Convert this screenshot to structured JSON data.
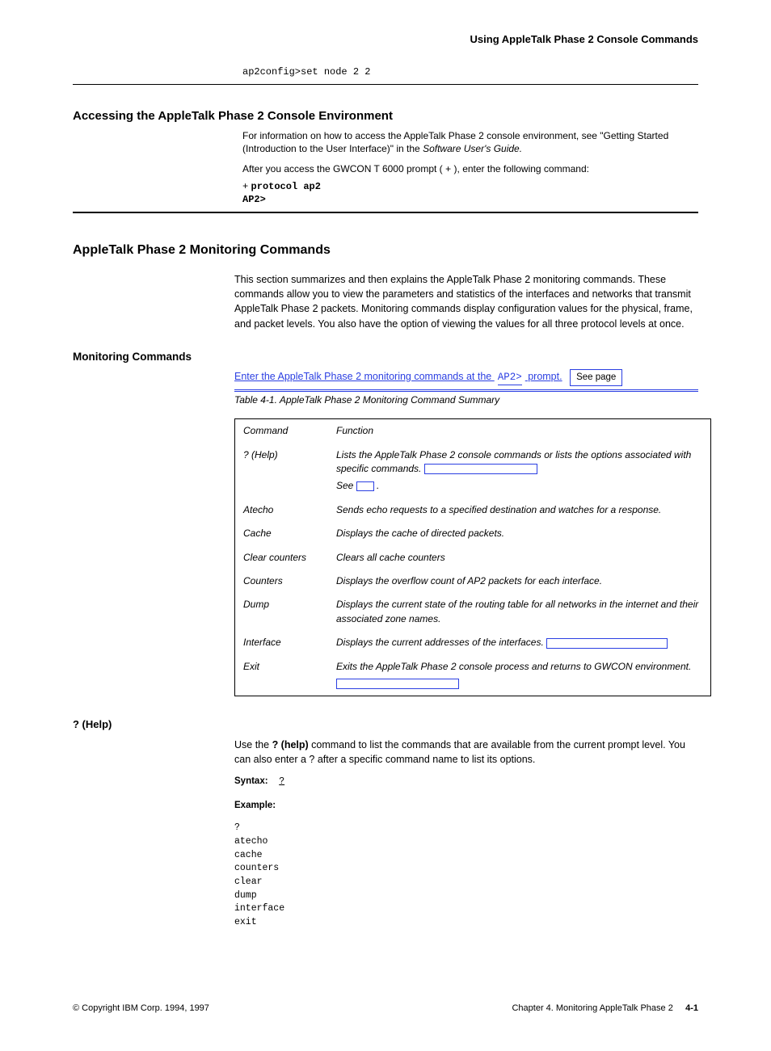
{
  "header": {
    "title": "Using AppleTalk Phase 2 Console Commands"
  },
  "top_example": "ap2config>set node 2 2",
  "section1": {
    "title": "Accessing the AppleTalk Phase 2 Console Environment",
    "line1_prefix": "For information on how to access the AppleTalk Phase 2 console environment, see",
    "line1_link": "\"Getting Started (Introduction to the User Interface)\"",
    "line1_suffix": " in the ",
    "line1_title": "Software User's Guide.",
    "plus": "+",
    "cmd": "protocol ap2",
    "promptline": "AP2>"
  },
  "section2": {
    "title": "AppleTalk Phase 2 Monitoring Commands",
    "para": "This section summarizes and then explains the AppleTalk Phase 2 monitoring commands. These commands allow you to view the parameters and statistics of the interfaces and networks that transmit AppleTalk Phase 2 packets. Monitoring commands display configuration values for the physical, frame, and packet levels. You also have the option of viewing the values for all three protocol levels at once.",
    "subhead": "Monitoring Commands",
    "table_intro_prefix": "Enter the AppleTalk Phase 2 monitoring commands at the ",
    "prompt": "AP2>",
    "table_intro_suffix": " prompt.",
    "see_page": "See page"
  },
  "table": {
    "caption": "Table 4-1. AppleTalk Phase 2 Monitoring Command Summary",
    "hdr_cmd": "Command",
    "hdr_func": "Function",
    "rows": [
      {
        "cmd": "? (Help)",
        "func_prefix": "Lists the AppleTalk Phase 2 console commands or lists the options associated with specific commands. ",
        "has_ref": true
      },
      {
        "cmd": "Atecho",
        "func_prefix": "Sends echo requests to a specified destination and watches for a response. ",
        "has_ref": false
      },
      {
        "cmd": "Cache",
        "func_prefix": "Displays the cache of directed packets. ",
        "has_ref": false
      },
      {
        "cmd": "Clear counters",
        "func_prefix": "Clears all cache counters ",
        "has_ref": false
      },
      {
        "cmd": "Counters",
        "func_prefix": "Displays the overflow count of AP2 packets for each interface. ",
        "has_ref": false
      },
      {
        "cmd": "Dump",
        "func_prefix": "Displays the current state of the routing table for all networks in the internet and their associated zone names. ",
        "has_ref": false
      },
      {
        "cmd": "Interface",
        "func_prefix": "Displays the current addresses of the interfaces. ",
        "has_ref": true
      },
      {
        "cmd": "Exit",
        "func_prefix": "Exits the AppleTalk Phase 2 console process and returns to GWCON environment.",
        "has_ref": true,
        "ref_below": true
      }
    ]
  },
  "help_cmd": {
    "title": "? (Help)",
    "desc_prefix": "Use the ",
    "desc_bold": "? (help)",
    "desc_rest": " command to list the commands that are available from the current prompt level. You can also enter a ? after a specific command name to list its options.",
    "syntax_label": "Syntax:",
    "syntax_val": "?",
    "example_label": "Example:",
    "example": "?\natecho\ncache\ncounters\nclear\ndump\ninterface\nexit"
  },
  "footer": {
    "left": "© Copyright IBM Corp. 1994, 1997",
    "right_ch": "Chapter 4. Monitoring AppleTalk Phase 2",
    "right_page": "4-1"
  }
}
